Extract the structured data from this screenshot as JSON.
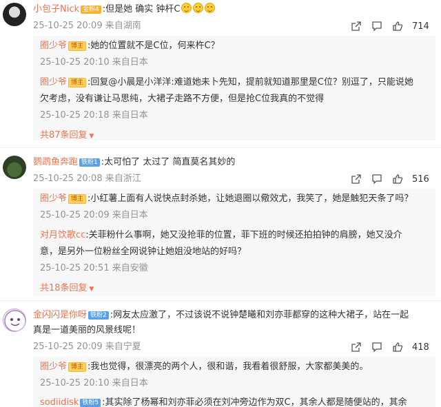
{
  "comments": [
    {
      "user": "小包子Nick",
      "badge": "金粉4",
      "text": ":但是她 确实 钟杆C",
      "meta": "25-10-25 20:09 来自湖南",
      "likes": "714",
      "replies": [
        {
          "user": "圈少爷",
          "badge": "博主",
          "lines": [
            ":她的位置就不是C位，何来杵C？"
          ],
          "meta": "25-10-25 20:10 来自日本"
        },
        {
          "user": "圈少爷",
          "badge": "博主",
          "lines": [
            ":回复@小晨是小洋洋:难道她未卜先知，提前就知道那里是C位？别逗了，只能说她",
            "欠考虑，没有谦让马思纯，大裙子走路不方便，但是抢C位我真的不觉得"
          ],
          "meta": "25-10-25 20:18 来自日本"
        }
      ],
      "more": "共87条回复"
    },
    {
      "user": "鹦鹉鱼奔跑",
      "badge": "铁粉1",
      "text": ":太可怕了 太过了 简直莫名其妙的",
      "meta": "25-10-25 20:08 来自浙江",
      "likes": "516",
      "replies": [
        {
          "user": "圈少爷",
          "badge": "博主",
          "lines": [
            ":小红薯上面有人说快点封杀她，让她退圈以儆效尤，我笑了，她是触犯天条了吗？"
          ],
          "meta": "25-10-25 20:09 来自日本"
        },
        {
          "user": "对月饮歌cc",
          "badge": "",
          "lines": [
            ":关菲粉什么事啊，她又没抢菲的位置，菲下班的时候还拍拍钟的肩膀，她又没介",
            "意，是另外一位粉丝全网说钟让她姐没地站的好吗？"
          ],
          "meta": "25-10-25 20:51 来自安徽"
        }
      ],
      "more": "共18条回复"
    },
    {
      "user": "金闪闪是你呀",
      "badge": "铁粉2",
      "text_lines": [
        ":网友太应激了，不过该说不说钟楚曦和刘亦菲都穿的这种大裙子，站在一起",
        "真是一道美丽的风景线呢！"
      ],
      "meta": "25-10-25 20:09 来自宁夏",
      "likes": "418",
      "replies": [
        {
          "user": "圈少爷",
          "badge": "博主",
          "lines": [
            ":我也觉得，很漂亮的两个人，很和谐，我看着很舒服，大家都美美的。"
          ],
          "meta": "25-10-25 20:10 来自日本"
        },
        {
          "user": "sodiidisk",
          "badge": "铁粉5",
          "lines": [
            ":其实除了杨幂和刘亦菲必须在刘冲旁边作为双C，其余人都是随便站的，其余"
          ],
          "meta": ""
        }
      ]
    }
  ],
  "colors": {
    "username": "#eb7350",
    "meta": "#939393",
    "reply_bg": "#f7f7f7"
  },
  "icons": [
    "share-icon",
    "comment-icon",
    "like-icon",
    "crying-emoji"
  ]
}
